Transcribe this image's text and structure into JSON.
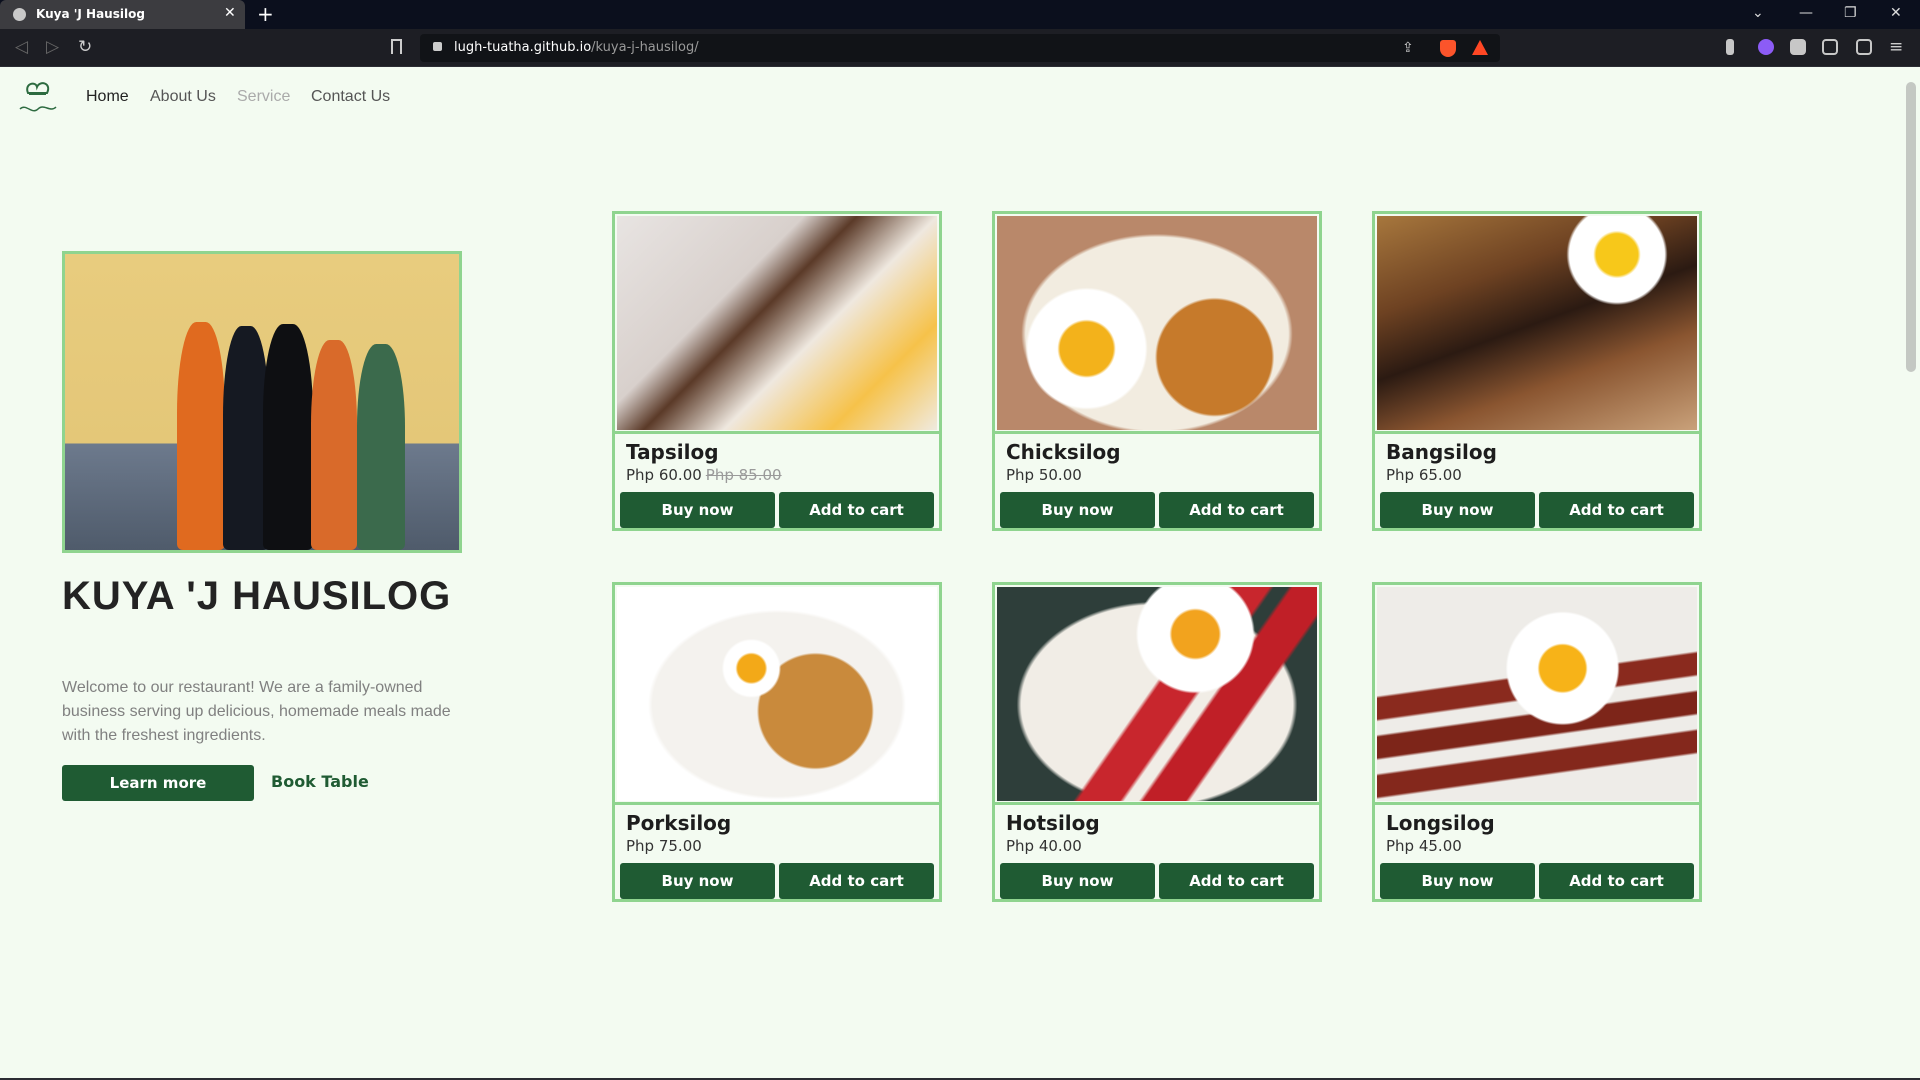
{
  "browser": {
    "tab_title": "Kuya 'J Hausilog",
    "url_host": "lugh-tuatha.github.io",
    "url_path": "/kuya-j-hausilog/",
    "new_tab": "+",
    "tab_close": "✕"
  },
  "nav": {
    "home": "Home",
    "about": "About Us",
    "service": "Service",
    "contact": "Contact Us"
  },
  "hero": {
    "title": "KUYA 'J HAUSILOG",
    "description": "Welcome to our restaurant! We are a family-owned business serving up delicious, homemade meals made with the freshest ingredients.",
    "learn_more": "Learn more",
    "book_table": "Book Table"
  },
  "products": [
    {
      "name": "Tapsilog",
      "price": "Php 60.00",
      "old_price": "Php 85.00",
      "buy": "Buy now",
      "cart": "Add to cart"
    },
    {
      "name": "Chicksilog",
      "price": "Php 50.00",
      "old_price": "",
      "buy": "Buy now",
      "cart": "Add to cart"
    },
    {
      "name": "Bangsilog",
      "price": "Php 65.00",
      "old_price": "",
      "buy": "Buy now",
      "cart": "Add to cart"
    },
    {
      "name": "Porksilog",
      "price": "Php 75.00",
      "old_price": "",
      "buy": "Buy now",
      "cart": "Add to cart"
    },
    {
      "name": "Hotsilog",
      "price": "Php 40.00",
      "old_price": "",
      "buy": "Buy now",
      "cart": "Add to cart"
    },
    {
      "name": "Longsilog",
      "price": "Php 45.00",
      "old_price": "",
      "buy": "Buy now",
      "cart": "Add to cart"
    }
  ],
  "colors": {
    "brand_green": "#1f5b33",
    "border_green": "#8fd48f",
    "page_bg": "#f3fbf1"
  }
}
